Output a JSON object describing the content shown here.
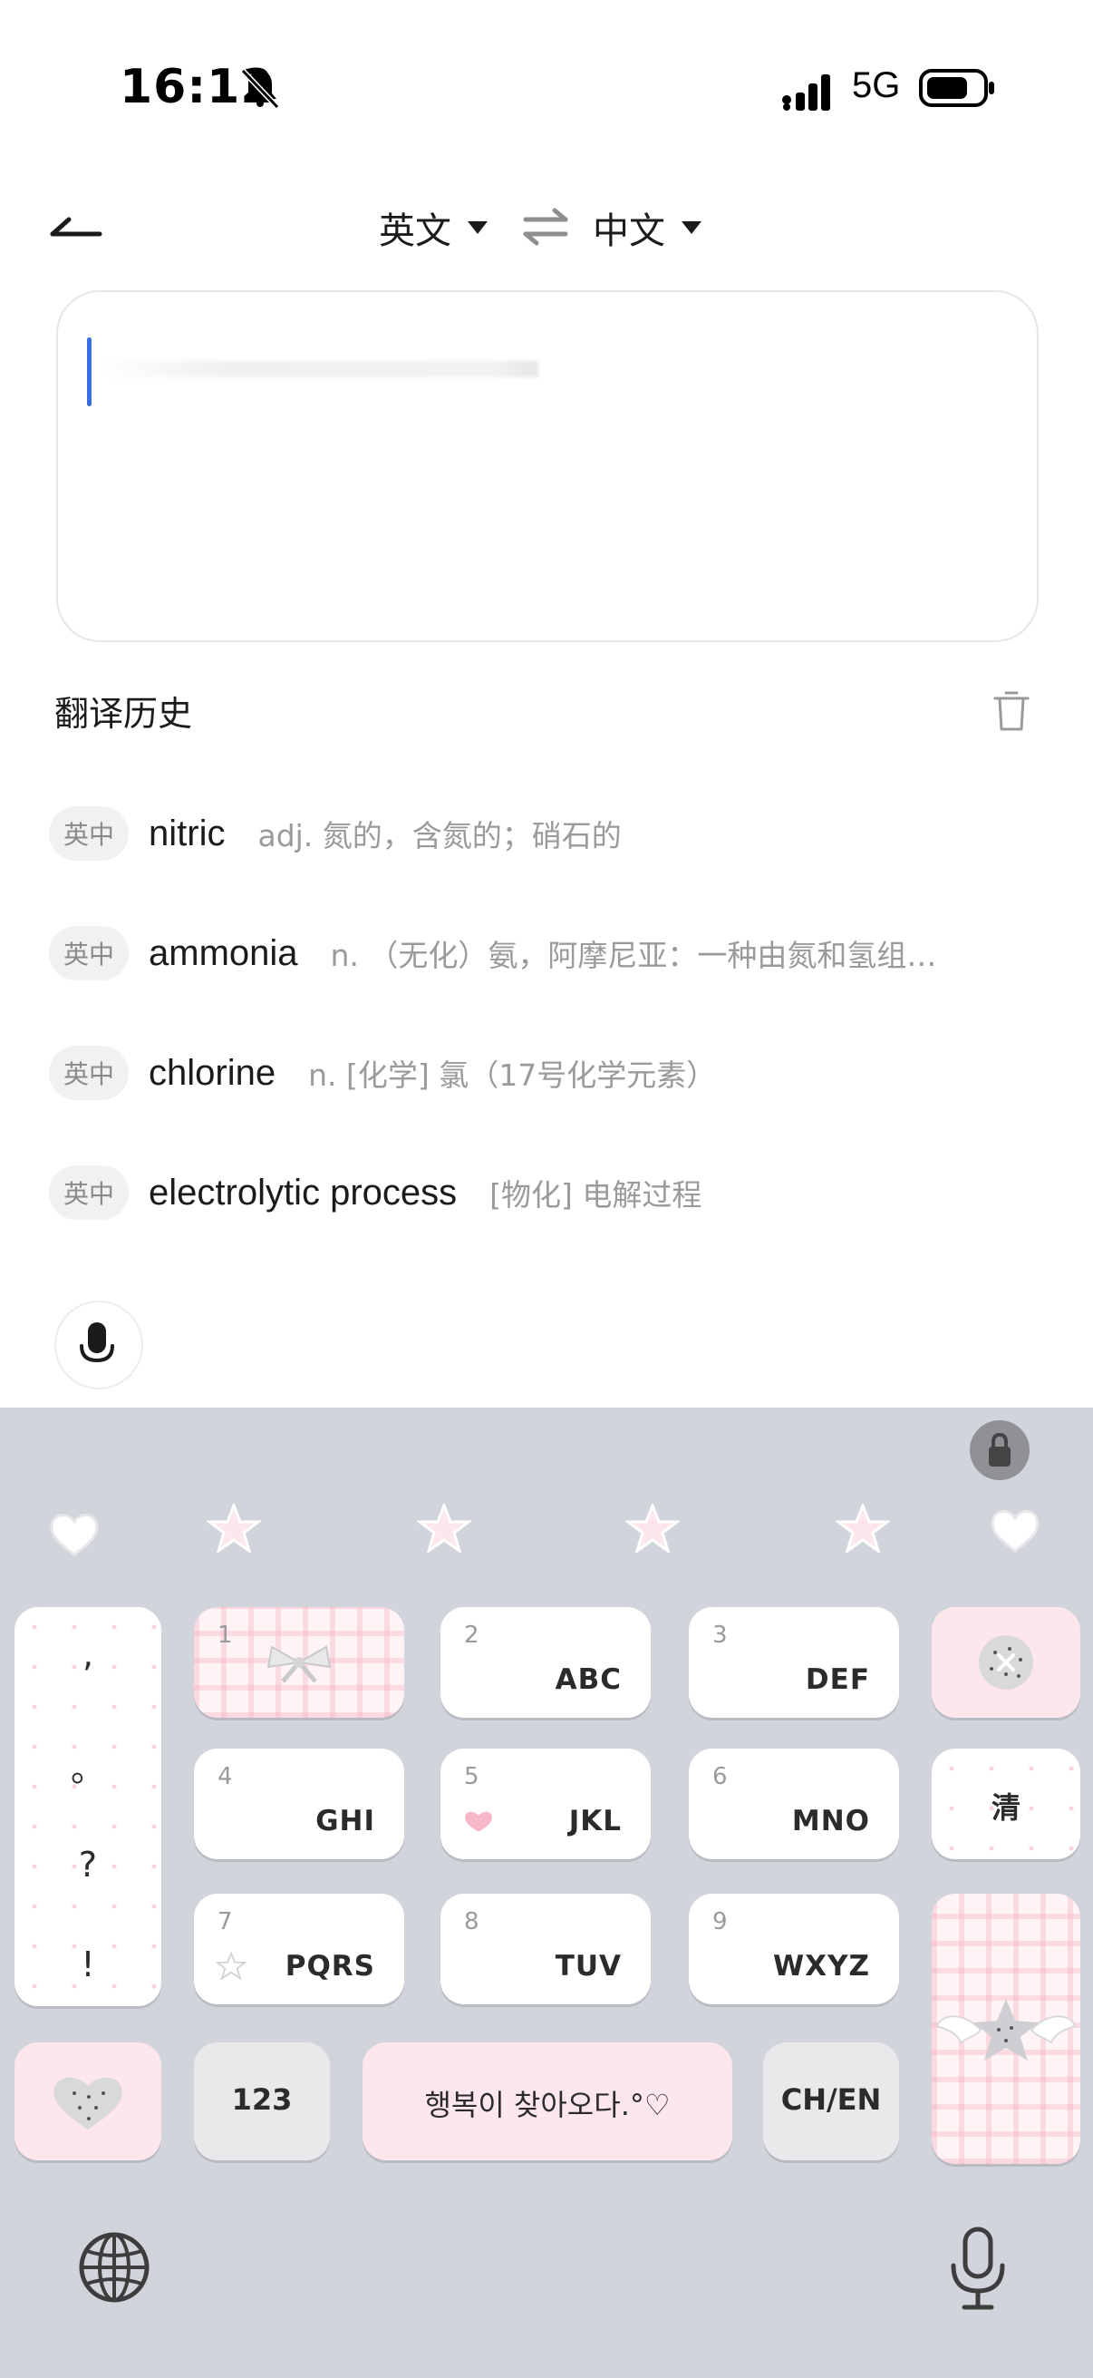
{
  "status": {
    "time": "16:12",
    "network": "5G"
  },
  "header": {
    "source_lang": "英文",
    "target_lang": "中文"
  },
  "history": {
    "title": "翻译历史",
    "items": [
      {
        "tag": "英中",
        "word": "nitric",
        "definition": "adj. 氮的，含氮的；硝石的"
      },
      {
        "tag": "英中",
        "word": "ammonia",
        "definition": "n. （无化）氨，阿摩尼亚：一种由氮和氢组…"
      },
      {
        "tag": "英中",
        "word": "chlorine",
        "definition": "n. [化学] 氯（17号化学元素）"
      },
      {
        "tag": "英中",
        "word": "electrolytic process",
        "definition": "[物化] 电解过程"
      }
    ]
  },
  "keyboard": {
    "punct": [
      ",",
      "。",
      "?",
      "!"
    ],
    "keys": [
      {
        "num": "1",
        "label": ""
      },
      {
        "num": "2",
        "label": "ABC"
      },
      {
        "num": "3",
        "label": "DEF"
      },
      {
        "num": "4",
        "label": "GHI"
      },
      {
        "num": "5",
        "label": "JKL"
      },
      {
        "num": "6",
        "label": "MNO"
      },
      {
        "num": "7",
        "label": "PQRS"
      },
      {
        "num": "8",
        "label": "TUV"
      },
      {
        "num": "9",
        "label": "WXYZ"
      }
    ],
    "clear": "清",
    "numbers": "123",
    "space_text": "행복이 찾아오다.°♡",
    "lang_switch": "CH/EN"
  },
  "colors": {
    "accent_cursor": "#3a6ee0",
    "keyboard_bg": "#d2d4dc",
    "pink_key": "#fde7ec"
  }
}
